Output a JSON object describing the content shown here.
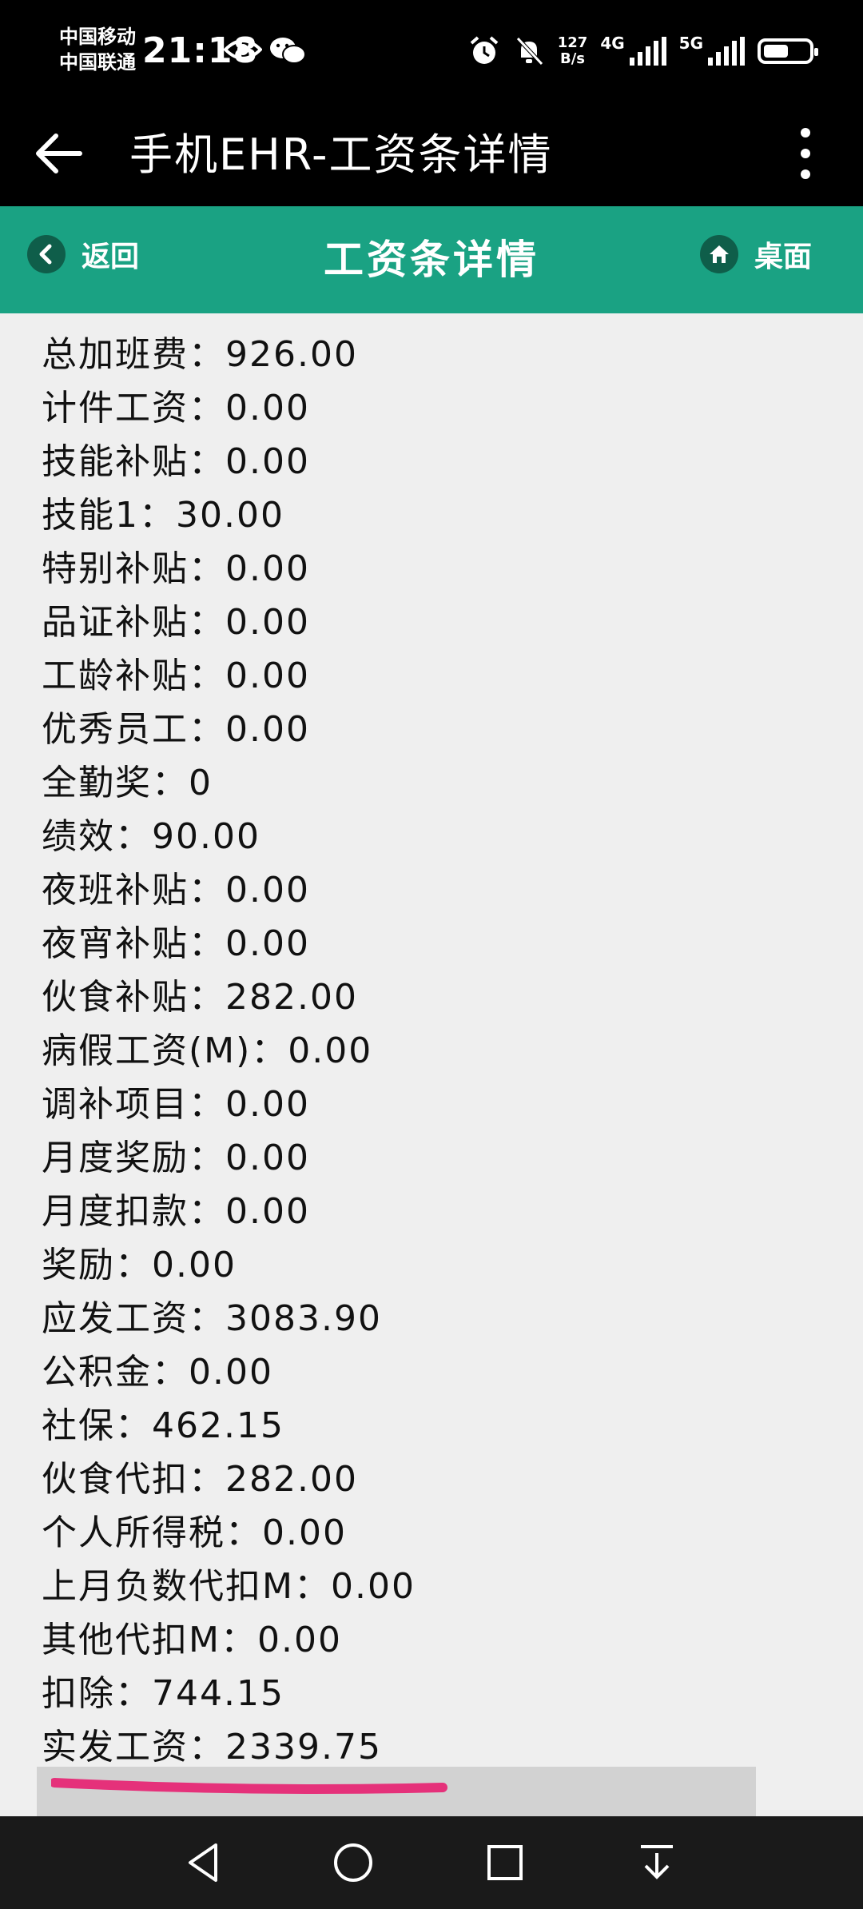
{
  "status_bar": {
    "carrier_1": "中国移动",
    "carrier_2": "中国联通",
    "time": "21:18",
    "net_speed_value": "127",
    "net_speed_unit": "B/s",
    "network_1": "4G",
    "network_2": "5G",
    "battery_level": 0.55
  },
  "app_bar": {
    "title": "手机EHR-工资条详情"
  },
  "header": {
    "back_label": "返回",
    "title": "工资条详情",
    "home_label": "桌面",
    "color": "#1aa283"
  },
  "salary_items": [
    {
      "label": "总加班费",
      "value": "926.00"
    },
    {
      "label": "计件工资",
      "value": "0.00"
    },
    {
      "label": "技能补贴",
      "value": "0.00"
    },
    {
      "label": "技能1",
      "value": "30.00"
    },
    {
      "label": "特别补贴",
      "value": "0.00"
    },
    {
      "label": "品证补贴",
      "value": "0.00"
    },
    {
      "label": "工龄补贴",
      "value": "0.00"
    },
    {
      "label": "优秀员工",
      "value": "0.00"
    },
    {
      "label": "全勤奖",
      "value": "0"
    },
    {
      "label": "绩效",
      "value": "90.00"
    },
    {
      "label": "夜班补贴",
      "value": "0.00"
    },
    {
      "label": "夜宵补贴",
      "value": "0.00"
    },
    {
      "label": "伙食补贴",
      "value": "282.00"
    },
    {
      "label": "病假工资(M)",
      "value": "0.00"
    },
    {
      "label": "调补项目",
      "value": "0.00"
    },
    {
      "label": "月度奖励",
      "value": "0.00"
    },
    {
      "label": "月度扣款",
      "value": "0.00"
    },
    {
      "label": "奖励",
      "value": "0.00"
    },
    {
      "label": "应发工资",
      "value": "3083.90"
    },
    {
      "label": "公积金",
      "value": "0.00"
    },
    {
      "label": "社保",
      "value": "462.15"
    },
    {
      "label": "伙食代扣",
      "value": "282.00"
    },
    {
      "label": "个人所得税",
      "value": "0.00"
    },
    {
      "label": "上月负数代扣M",
      "value": "0.00"
    },
    {
      "label": "其他代扣M",
      "value": "0.00"
    },
    {
      "label": "扣除",
      "value": "744.15"
    },
    {
      "label": "实发工资",
      "value": "2339.75"
    }
  ],
  "separator": "：",
  "highlight_color": "#e5317a"
}
